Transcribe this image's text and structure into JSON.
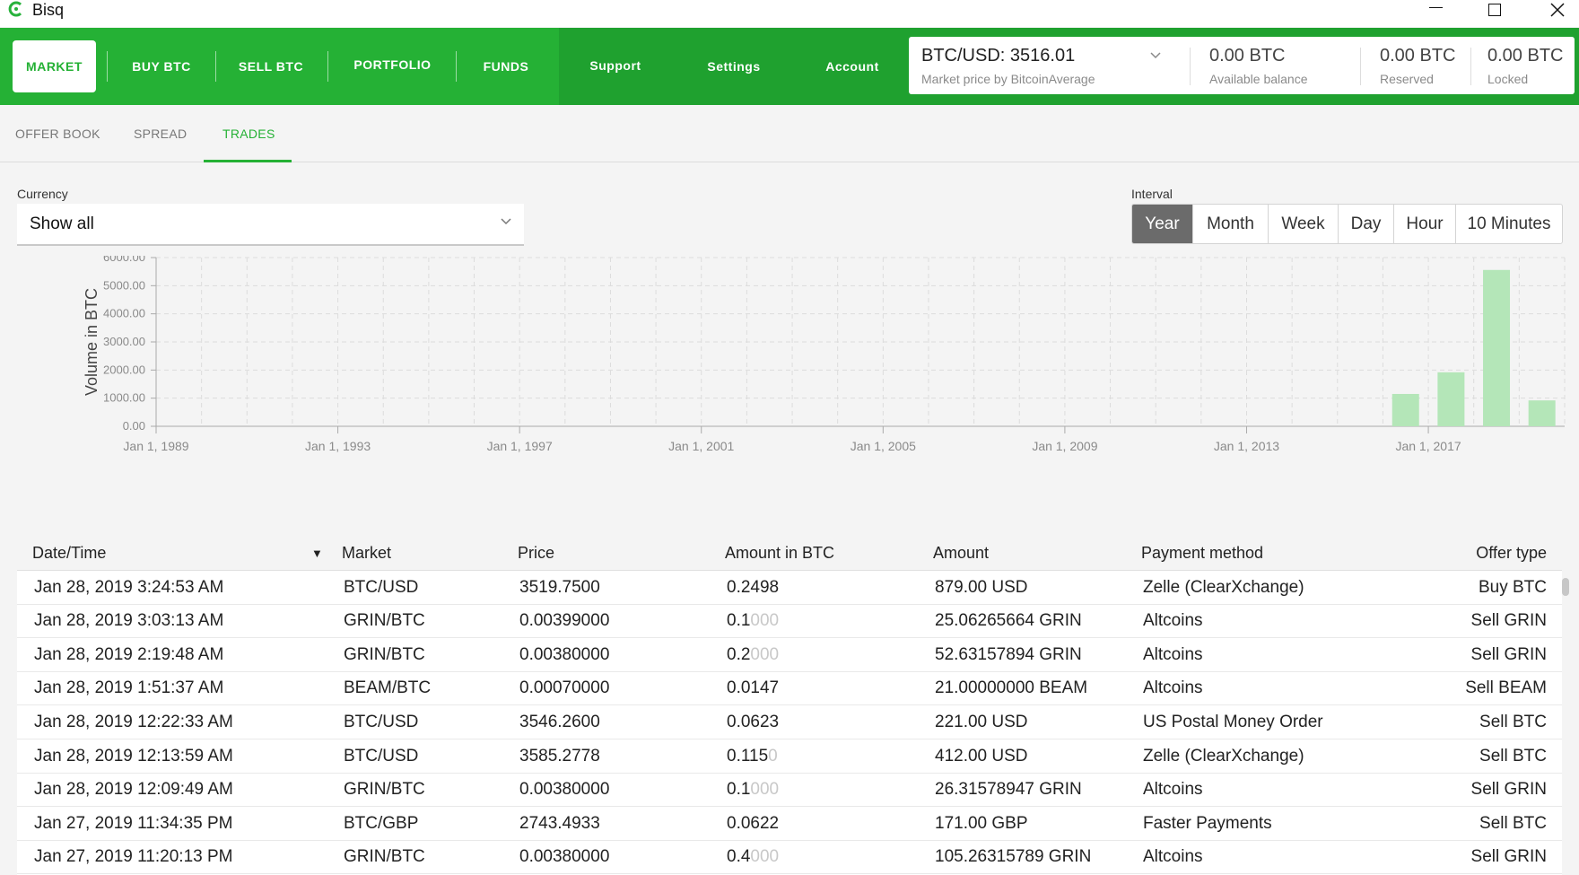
{
  "window": {
    "title": "Bisq",
    "logo_icon": "bisq-logo-icon"
  },
  "nav": {
    "items": [
      {
        "label": "MARKET",
        "active": true
      },
      {
        "label": "BUY BTC"
      },
      {
        "label": "SELL BTC"
      },
      {
        "label": "PORTFOLIO"
      },
      {
        "label": "FUNDS"
      },
      {
        "label": "Support"
      },
      {
        "label": "Settings"
      },
      {
        "label": "Account"
      }
    ]
  },
  "price_panel": {
    "market_price": "BTC/USD: 3516.01",
    "market_source": "Market price by BitcoinAverage",
    "available_value": "0.00 BTC",
    "available_label": "Available balance",
    "reserved_value": "0.00 BTC",
    "reserved_label": "Reserved",
    "locked_value": "0.00 BTC",
    "locked_label": "Locked"
  },
  "subtabs": [
    {
      "label": "OFFER BOOK"
    },
    {
      "label": "SPREAD"
    },
    {
      "label": "TRADES",
      "active": true
    }
  ],
  "currency": {
    "label": "Currency",
    "value": "Show all"
  },
  "interval": {
    "label": "Interval",
    "options": [
      "Year",
      "Month",
      "Week",
      "Day",
      "Hour",
      "10 Minutes"
    ],
    "selected": "Year"
  },
  "chart_data": {
    "type": "bar",
    "ylabel": "Volume in BTC",
    "xlabel": "",
    "ylim": [
      0,
      6000
    ],
    "yticks": [
      "6000.00",
      "5000.00",
      "4000.00",
      "3000.00",
      "2000.00",
      "1000.00",
      "0.00"
    ],
    "xticks": [
      "Jan 1, 1989",
      "Jan 1, 1993",
      "Jan 1, 1997",
      "Jan 1, 2001",
      "Jan 1, 2005",
      "Jan 1, 2009",
      "Jan 1, 2013",
      "Jan 1, 2017"
    ],
    "x_range": [
      1989,
      2020
    ],
    "categories": [
      "2016",
      "2017",
      "2018",
      "2019"
    ],
    "values": [
      1150,
      1920,
      5560,
      920
    ],
    "bar_color": "#b4e6b8",
    "grid": true
  },
  "table": {
    "columns": [
      "Date/Time",
      "Market",
      "Price",
      "Amount in BTC",
      "Amount",
      "Payment method",
      "Offer type"
    ],
    "rows": [
      {
        "date": "Jan 28, 2019 3:24:53 AM",
        "market": "BTC/USD",
        "price": "3519.7500",
        "btc": "0.2498",
        "btc_pad": "",
        "amount": "879.00 USD",
        "method": "Zelle (ClearXchange)",
        "type": "Buy BTC"
      },
      {
        "date": "Jan 28, 2019 3:03:13 AM",
        "market": "GRIN/BTC",
        "price": "0.00399000",
        "btc": "0.1",
        "btc_pad": "000",
        "amount": "25.06265664 GRIN",
        "method": "Altcoins",
        "type": "Sell GRIN"
      },
      {
        "date": "Jan 28, 2019 2:19:48 AM",
        "market": "GRIN/BTC",
        "price": "0.00380000",
        "btc": "0.2",
        "btc_pad": "000",
        "amount": "52.63157894 GRIN",
        "method": "Altcoins",
        "type": "Sell GRIN"
      },
      {
        "date": "Jan 28, 2019 1:51:37 AM",
        "market": "BEAM/BTC",
        "price": "0.00070000",
        "btc": "0.0147",
        "btc_pad": "",
        "amount": "21.00000000 BEAM",
        "method": "Altcoins",
        "type": "Sell BEAM"
      },
      {
        "date": "Jan 28, 2019 12:22:33 AM",
        "market": "BTC/USD",
        "price": "3546.2600",
        "btc": "0.0623",
        "btc_pad": "",
        "amount": "221.00 USD",
        "method": "US Postal Money Order",
        "type": "Sell BTC"
      },
      {
        "date": "Jan 28, 2019 12:13:59 AM",
        "market": "BTC/USD",
        "price": "3585.2778",
        "btc": "0.115",
        "btc_pad": "0",
        "amount": "412.00 USD",
        "method": "Zelle (ClearXchange)",
        "type": "Sell BTC"
      },
      {
        "date": "Jan 28, 2019 12:09:49 AM",
        "market": "GRIN/BTC",
        "price": "0.00380000",
        "btc": "0.1",
        "btc_pad": "000",
        "amount": "26.31578947 GRIN",
        "method": "Altcoins",
        "type": "Sell GRIN"
      },
      {
        "date": "Jan 27, 2019 11:34:35 PM",
        "market": "BTC/GBP",
        "price": "2743.4933",
        "btc": "0.0622",
        "btc_pad": "",
        "amount": "171.00 GBP",
        "method": "Faster Payments",
        "type": "Sell BTC"
      },
      {
        "date": "Jan 27, 2019 11:20:13 PM",
        "market": "GRIN/BTC",
        "price": "0.00380000",
        "btc": "0.4",
        "btc_pad": "000",
        "amount": "105.26315789 GRIN",
        "method": "Altcoins",
        "type": "Sell GRIN"
      }
    ]
  }
}
